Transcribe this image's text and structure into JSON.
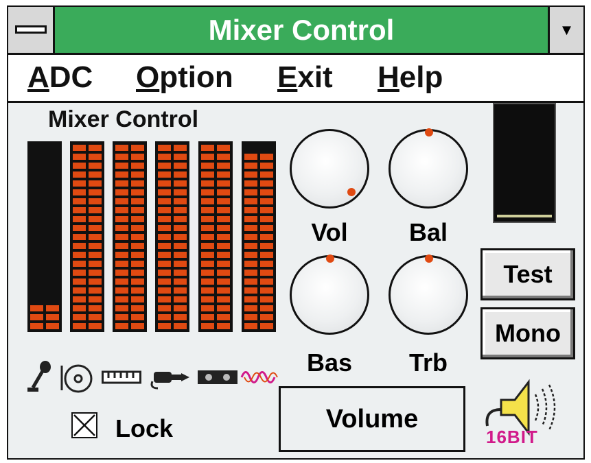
{
  "window": {
    "title": "Mixer Control"
  },
  "menu": [
    {
      "underline": "A",
      "rest": "DC"
    },
    {
      "underline": "O",
      "rest": "ption"
    },
    {
      "underline": "E",
      "rest": "xit"
    },
    {
      "underline": "H",
      "rest": "elp"
    }
  ],
  "panel": {
    "heading": "Mixer Control"
  },
  "meters": [
    {
      "icon": "microphone-icon",
      "lit_segments": 3
    },
    {
      "icon": "cd-disc-icon",
      "lit_segments": 21
    },
    {
      "icon": "keyboard-icon",
      "lit_segments": 21
    },
    {
      "icon": "line-in-jack-icon",
      "lit_segments": 21
    },
    {
      "icon": "tape-icon",
      "lit_segments": 21
    },
    {
      "icon": "wave-icon",
      "lit_segments": 20
    }
  ],
  "knobs": {
    "vol": {
      "label": "Vol"
    },
    "bal": {
      "label": "Bal"
    },
    "bas": {
      "label": "Bas"
    },
    "trb": {
      "label": "Trb"
    }
  },
  "buttons": {
    "test": "Test",
    "mono": "Mono"
  },
  "lock": {
    "label": "Lock",
    "checked": true
  },
  "volume_label": "Volume",
  "badge": {
    "text": "16BIT"
  },
  "colors": {
    "title_bar": "#3aab5a",
    "segment": "#e04a12",
    "badge": "#d11a8a"
  }
}
